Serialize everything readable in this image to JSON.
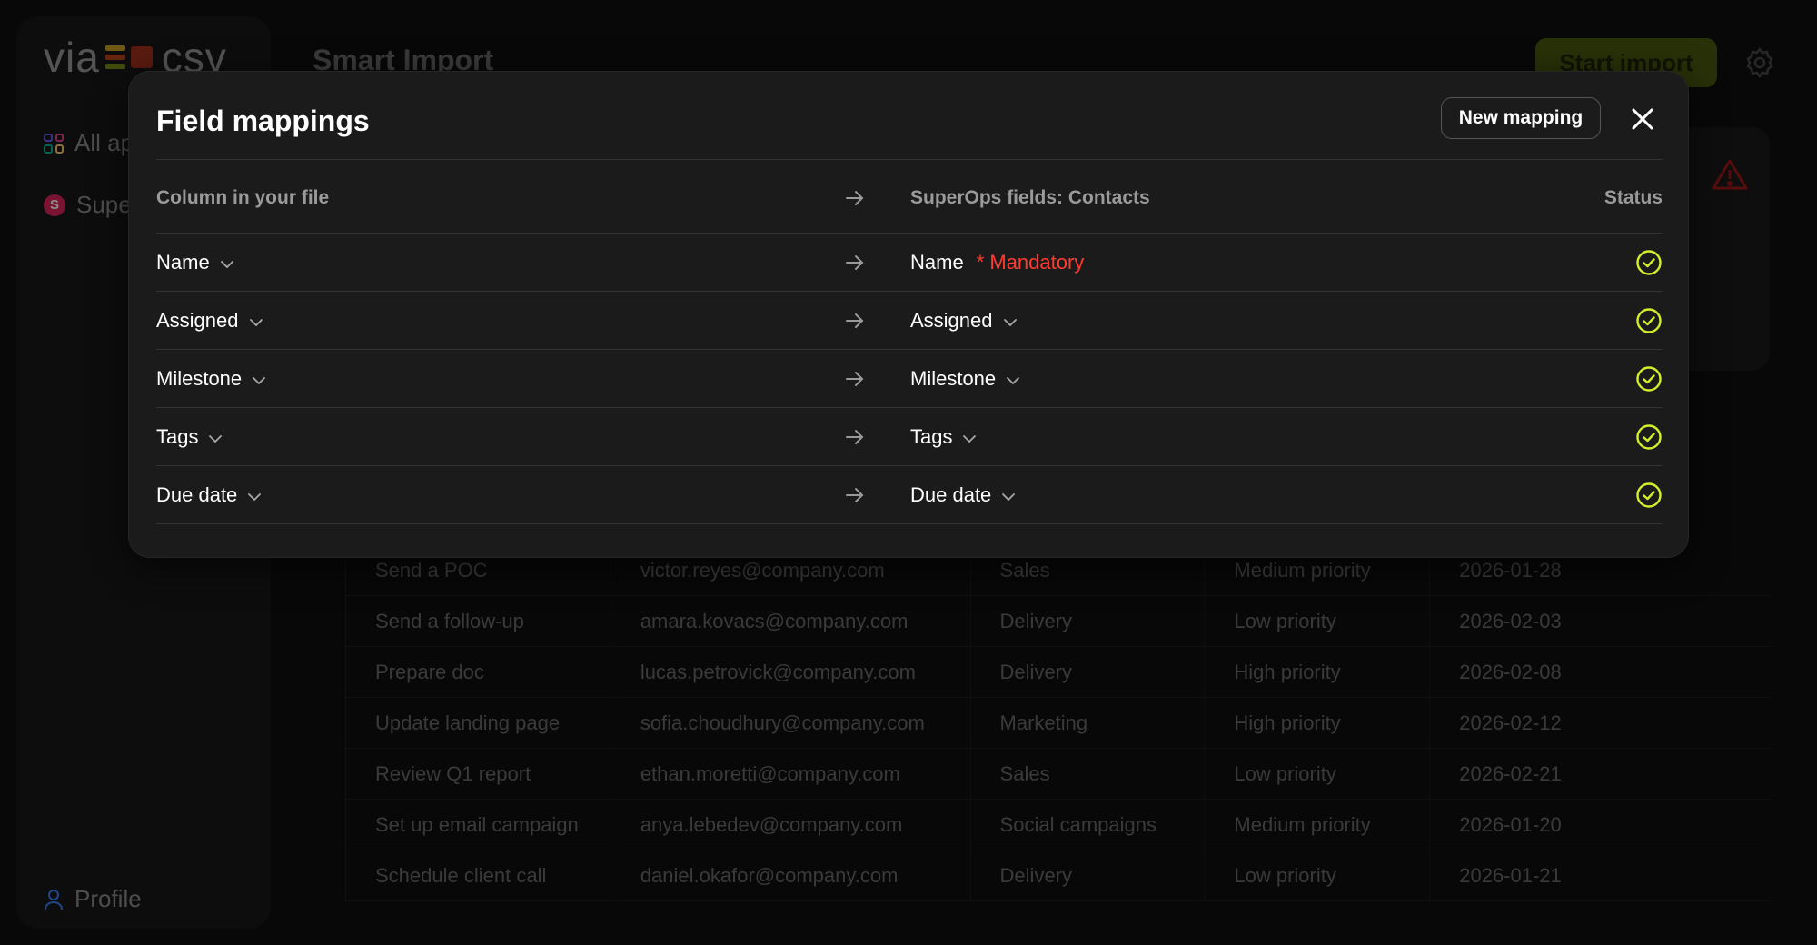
{
  "app": {
    "logo_left": "via",
    "logo_right": "csv",
    "nav_all_apps": "All ap",
    "nav_superops": "Supe",
    "nav_profile": "Profile",
    "page_title": "Smart Import",
    "start_import": "Start import"
  },
  "background_table": {
    "rows": [
      [
        "Send a POC",
        "victor.reyes@company.com",
        "Sales",
        "Medium priority",
        "2026-01-28"
      ],
      [
        "Send a follow-up",
        "amara.kovacs@company.com",
        "Delivery",
        "Low priority",
        "2026-02-03"
      ],
      [
        "Prepare doc",
        "lucas.petrovick@company.com",
        "Delivery",
        "High priority",
        "2026-02-08"
      ],
      [
        "Update landing page",
        "sofia.choudhury@company.com",
        "Marketing",
        "High priority",
        "2026-02-12"
      ],
      [
        "Review Q1 report",
        "ethan.moretti@company.com",
        "Sales",
        "Low priority",
        "2026-02-21"
      ],
      [
        "Set up email campaign",
        "anya.lebedev@company.com",
        "Social campaigns",
        "Medium priority",
        "2026-01-20"
      ],
      [
        "Schedule client call",
        "daniel.okafor@company.com",
        "Delivery",
        "Low priority",
        "2026-01-21"
      ]
    ]
  },
  "modal": {
    "title": "Field mappings",
    "new_mapping": "New mapping",
    "header": {
      "left": "Column in your file",
      "right": "SuperOps fields: Contacts",
      "status": "Status"
    },
    "mandatory_label": "* Mandatory",
    "rows": [
      {
        "source": "Name",
        "target": "Name"
      },
      {
        "source": "Assigned",
        "target": "Assigned"
      },
      {
        "source": "Milestone",
        "target": "Milestone"
      },
      {
        "source": "Tags",
        "target": "Tags"
      },
      {
        "source": "Due date",
        "target": "Due date"
      }
    ]
  },
  "colors": {
    "accent_check": "#d4ef2a",
    "mandatory": "#ff3b30",
    "start_button": "#4a5a10"
  }
}
